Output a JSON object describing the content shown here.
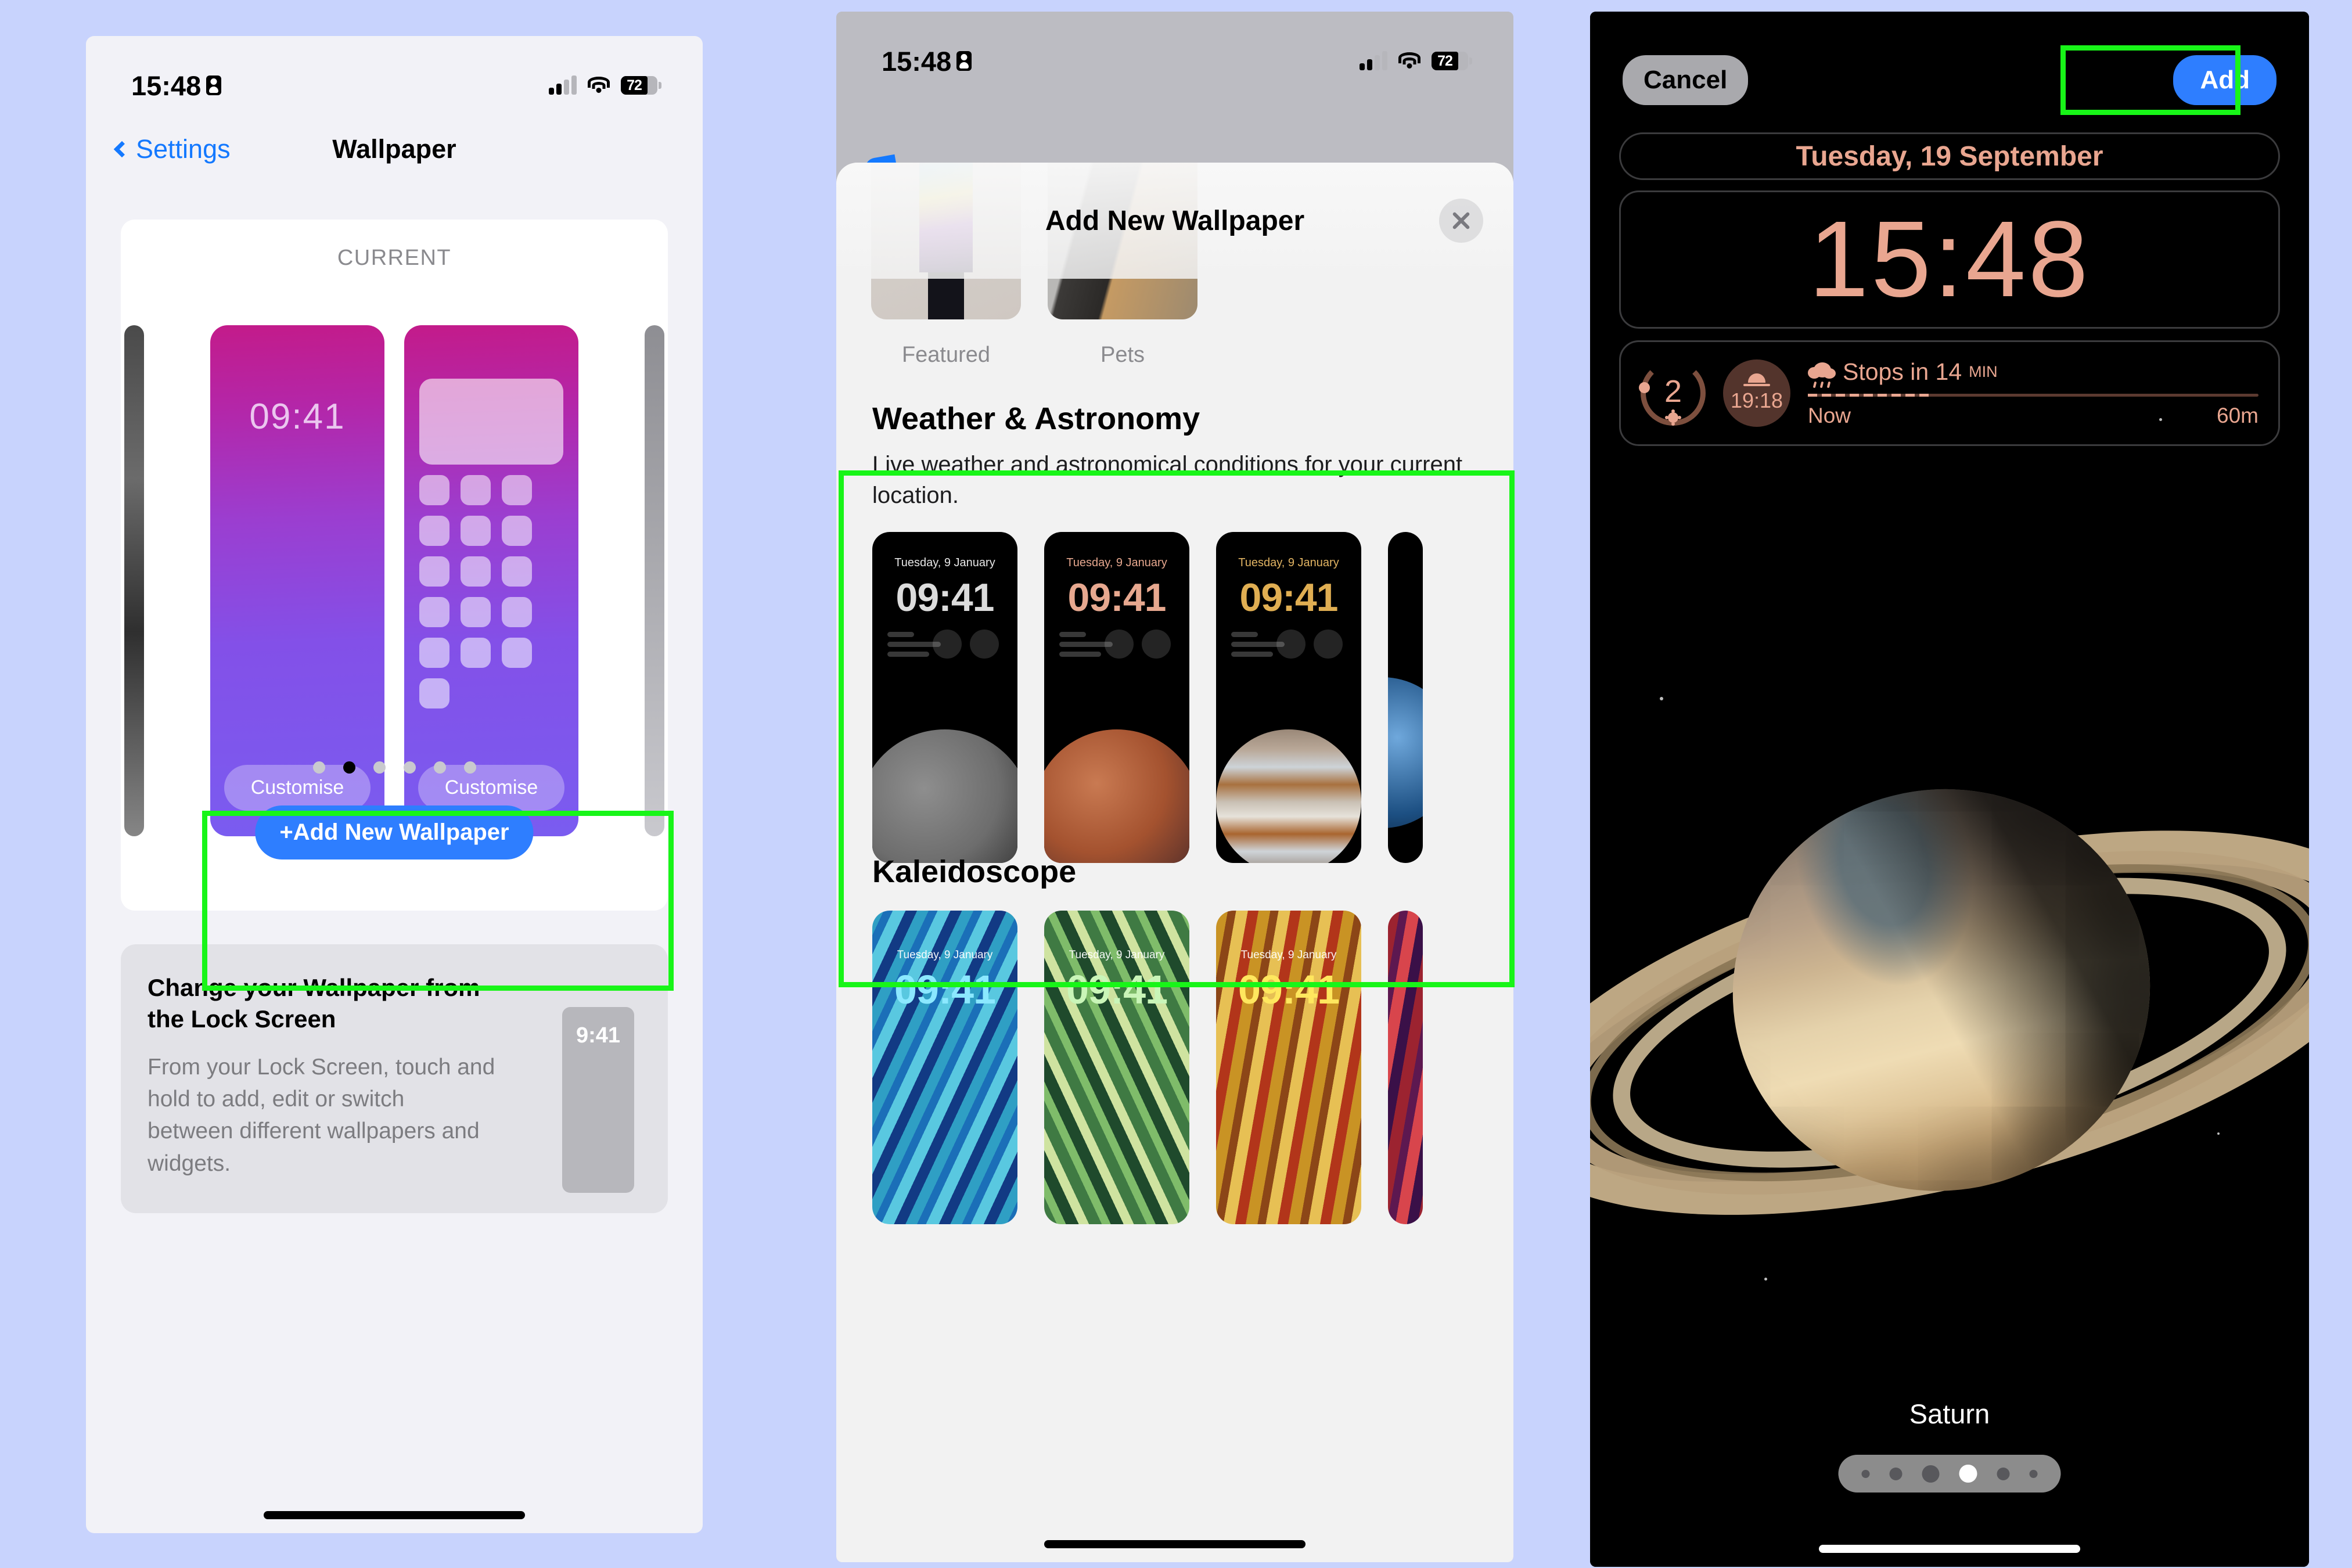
{
  "background_color": "#c8d3fd",
  "highlight_color": "#18f518",
  "status_bar": {
    "time": "15:48",
    "battery_level": "72",
    "icons": [
      "screen-record-icon",
      "cellular-signal-icon",
      "wifi-icon",
      "battery-icon"
    ]
  },
  "panel1": {
    "nav": {
      "back_label": "Settings",
      "title": "Wallpaper"
    },
    "current_label": "CURRENT",
    "wallpaper_lock_time": "09:41",
    "customise_label": "Customise",
    "page_dots": {
      "count": 6,
      "active_index": 1
    },
    "add_button_label": "+Add New Wallpaper",
    "tip": {
      "title": "Change your Wallpaper from the Lock Screen",
      "body": "From your Lock Screen, touch and hold to add, edit or switch between different wallpapers and widgets.",
      "thumb_time": "9:41"
    }
  },
  "panel2": {
    "sheet_title": "Add New Wallpaper",
    "close_icon": "close-icon",
    "photo_categories": [
      {
        "label": "Featured"
      },
      {
        "label": "Pets"
      }
    ],
    "sections": [
      {
        "title": "Weather & Astronomy",
        "subtitle": "Live weather and astronomical conditions for your current location.",
        "thumbs": [
          {
            "name": "Moon",
            "date": "Tuesday, 9 January",
            "time": "09:41"
          },
          {
            "name": "Mars",
            "date": "Tuesday, 9 January",
            "time": "09:41"
          },
          {
            "name": "Jupiter",
            "date": "Tuesday, 9 January",
            "time": "09:41"
          }
        ]
      },
      {
        "title": "Kaleidoscope",
        "thumbs": [
          {
            "name": "Blue",
            "date": "Tuesday, 9 January",
            "time": "09:41"
          },
          {
            "name": "Green",
            "date": "Tuesday, 9 January",
            "time": "09:41"
          },
          {
            "name": "Gold",
            "date": "Tuesday, 9 January",
            "time": "09:41"
          }
        ]
      }
    ]
  },
  "panel3": {
    "cancel_label": "Cancel",
    "add_label": "Add",
    "date": "Tuesday, 19 September",
    "time": "15:48",
    "accent_color": "#e9a690",
    "widgets": {
      "uv_index_value": "2",
      "sunset_time": "19:18",
      "rain_text": "Stops in 14",
      "rain_unit": "MIN",
      "chart_start_label": "Now",
      "chart_end_label": "60m"
    },
    "wallpaper_name": "Saturn",
    "page_dots": {
      "count": 6,
      "active_index": 3
    }
  }
}
